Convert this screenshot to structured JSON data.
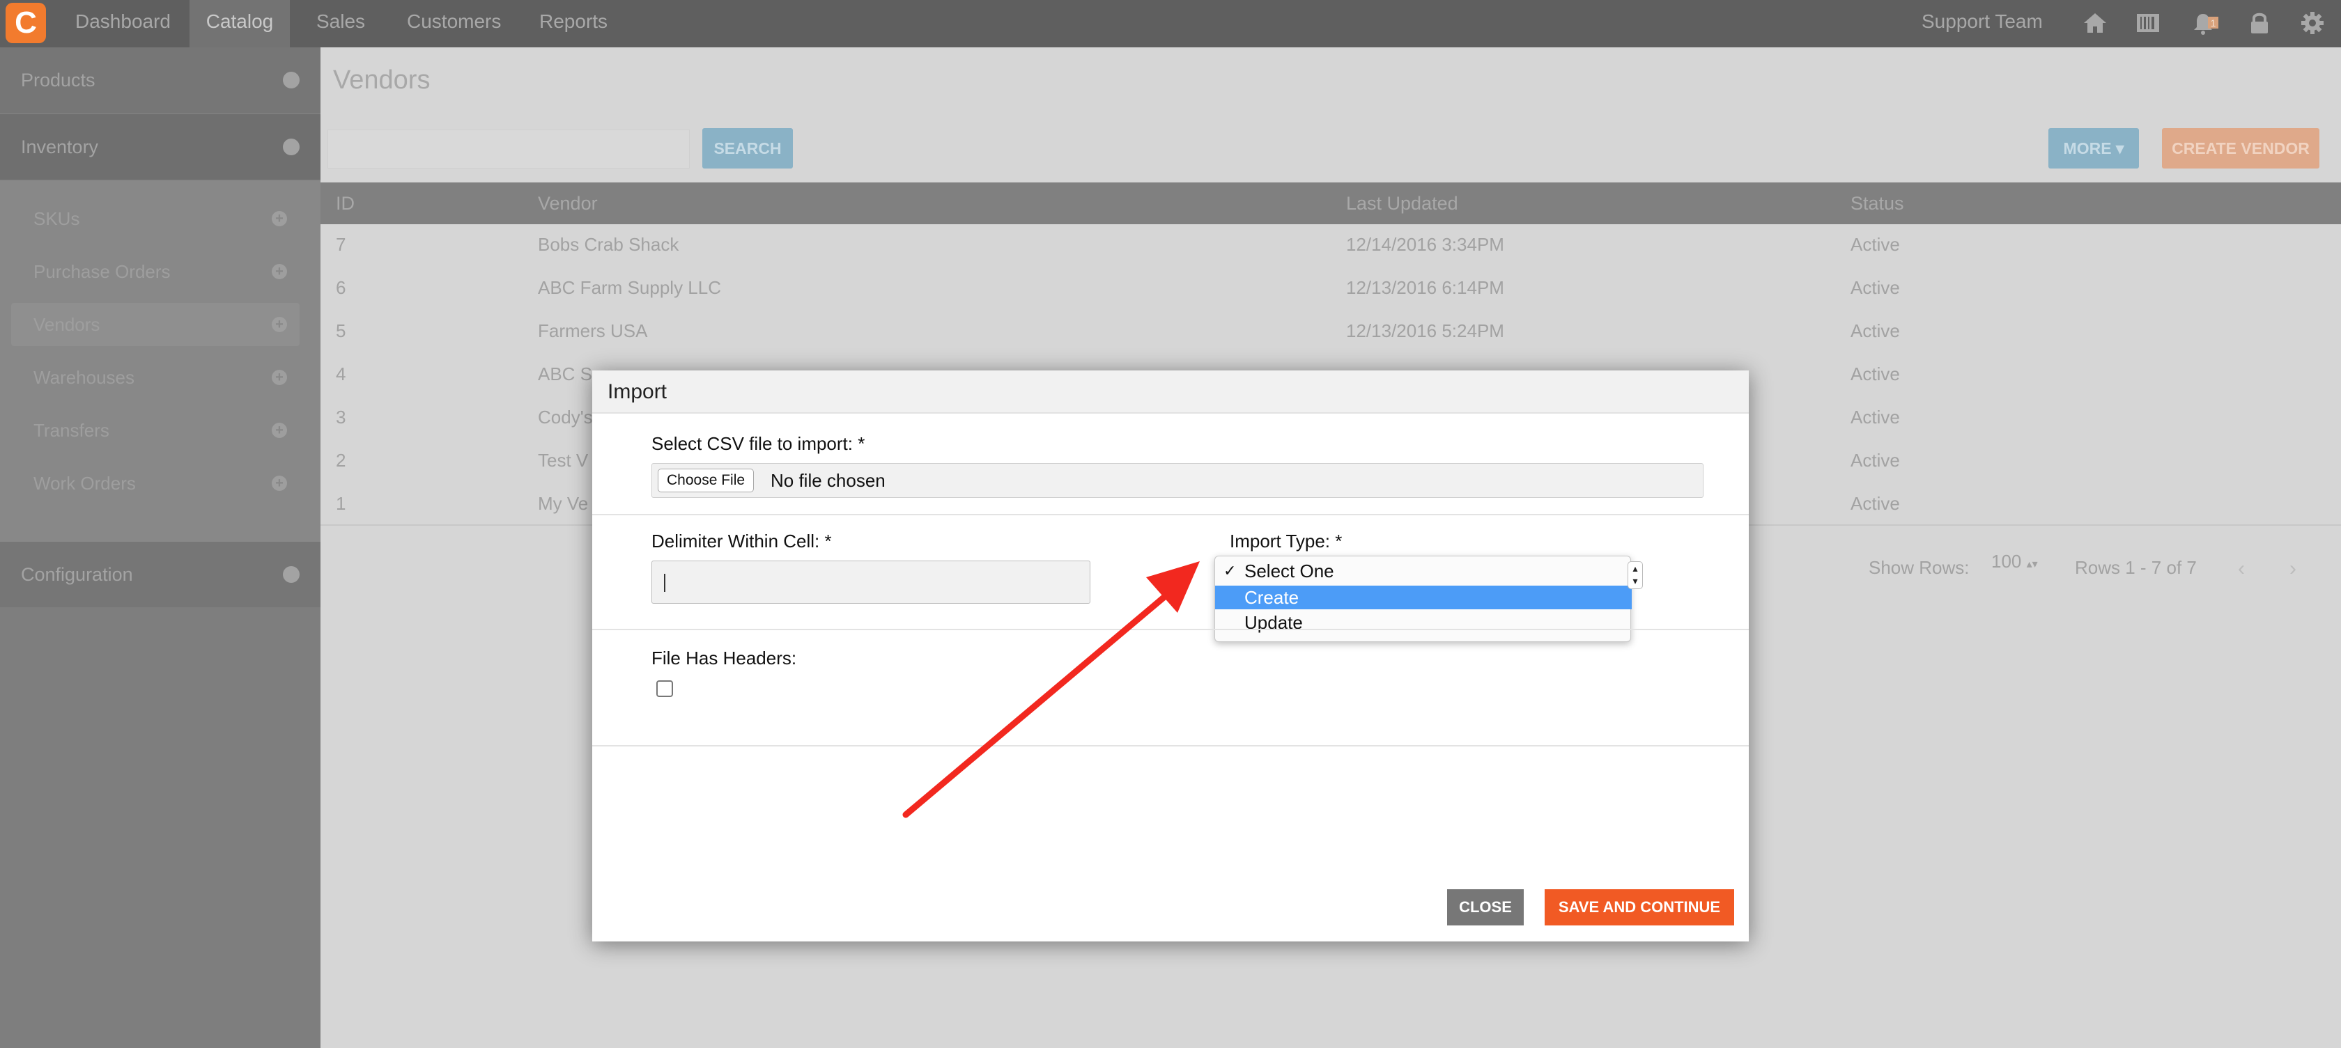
{
  "colors": {
    "accent_orange": "#f15a24",
    "accent_blue": "#4c9cf7",
    "annotation_red": "#f2281f"
  },
  "topnav": {
    "logo": "C",
    "items": [
      "Dashboard",
      "Catalog",
      "Sales",
      "Customers",
      "Reports"
    ],
    "active": "Catalog",
    "user": "Support Team",
    "icons": [
      "home-icon",
      "barcode-icon",
      "notification-icon",
      "lock-icon",
      "gear-icon"
    ],
    "notification_count": "1"
  },
  "sidebar": {
    "products": "Products",
    "inventory": "Inventory",
    "items": [
      {
        "label": "SKUs"
      },
      {
        "label": "Purchase Orders"
      },
      {
        "label": "Vendors"
      },
      {
        "label": "Warehouses"
      },
      {
        "label": "Transfers"
      },
      {
        "label": "Work Orders"
      }
    ],
    "configuration": "Configuration"
  },
  "main": {
    "title": "Vendors",
    "search_button": "SEARCH",
    "more_button": "MORE ▾",
    "create_button": "CREATE VENDOR",
    "columns": [
      "ID",
      "Vendor",
      "Last Updated",
      "Status"
    ],
    "rows": [
      {
        "id": "7",
        "vendor": "Bobs Crab Shack",
        "updated": "12/14/2016 3:34PM",
        "status": "Active"
      },
      {
        "id": "6",
        "vendor": "ABC Farm Supply LLC",
        "updated": "12/13/2016 6:14PM",
        "status": "Active"
      },
      {
        "id": "5",
        "vendor": "Farmers USA",
        "updated": "12/13/2016 5:24PM",
        "status": "Active"
      },
      {
        "id": "4",
        "vendor": "ABC S",
        "updated": "",
        "status": "Active"
      },
      {
        "id": "3",
        "vendor": "Cody's",
        "updated": "",
        "status": "Active"
      },
      {
        "id": "2",
        "vendor": "Test V",
        "updated": "",
        "status": "Active"
      },
      {
        "id": "1",
        "vendor": "My Ve",
        "updated": "",
        "status": "Active"
      }
    ],
    "show_rows_label": "Show Rows:",
    "rows_per_page": "100",
    "rows_info": "Rows 1 - 7 of 7"
  },
  "modal": {
    "title": "Import",
    "csv_label": "Select CSV file to import: *",
    "choose_file": "Choose File",
    "file_status": "No file chosen",
    "delimiter_label": "Delimiter Within Cell: *",
    "import_type_label": "Import Type: *",
    "import_options": [
      {
        "label": "Select One",
        "checked": "✓"
      },
      {
        "label": "Create",
        "checked": ""
      },
      {
        "label": "Update",
        "checked": ""
      }
    ],
    "headers_label": "File Has Headers:",
    "close_button": "CLOSE",
    "save_button": "SAVE AND CONTINUE"
  }
}
